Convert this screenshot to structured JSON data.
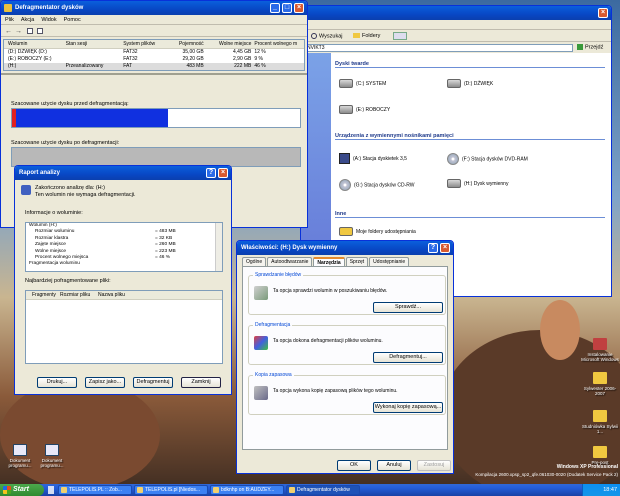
{
  "desktop": {
    "icons": [
      {
        "label": "Instalowanie Microsoft Windows"
      },
      {
        "label": "Sylwester 2006-2007"
      },
      {
        "label": "Studniówka Sylwii 1..."
      },
      {
        "label": "Pre-post"
      }
    ],
    "left_icons": [
      {
        "label": "Dokument programu..."
      },
      {
        "label": "Dokument programu..."
      }
    ],
    "watermark": [
      "Windows XP Professional",
      "Kompilacja 2600.xpsp_sp2_qfe.061030-0020 (Dodatek Service Pack 2)"
    ]
  },
  "explorer": {
    "toolbar": {
      "search": "Wyszukaj",
      "folders": "Foldery"
    },
    "address": {
      "value": "NVIKT3",
      "go": "Przejdź"
    },
    "sections": {
      "hard_drives": "Dyski twarde",
      "removable": "Urządzenia z wymiennymi nośnikami pamięci",
      "other": "Inne"
    },
    "drives": [
      {
        "label": "(C:) SYSTEM"
      },
      {
        "label": "(D:) DŹWIĘK"
      },
      {
        "label": "(E:) ROBOCZY"
      }
    ],
    "removable": [
      {
        "label": "(A:) Stacja dyskietek 3,5"
      },
      {
        "label": "(F:) Stacja dysków DVD-RAM"
      },
      {
        "label": "(G:) Stacja dysków CD-RW"
      },
      {
        "label": "(H:) Dysk wymienny"
      }
    ],
    "other": [
      {
        "label": "Moje foldery udostępniania"
      }
    ]
  },
  "defrag": {
    "title": "Defragmentator dysków",
    "menu": [
      "Plik",
      "Akcja",
      "Widok",
      "Pomoc"
    ],
    "columns": [
      "Wolumin",
      "Stan sesji",
      "System plików",
      "Pojemność",
      "Wolne miejsce",
      "Procent wolnego m"
    ],
    "rows": [
      [
        "(D:) DŹWIĘK (D:)",
        "",
        "FAT32",
        "35,00 GB",
        "4,45 GB",
        "12 %"
      ],
      [
        "(E:) ROBOCZY (E:)",
        "",
        "FAT32",
        "29,20 GB",
        "2,90 GB",
        "9 %"
      ],
      [
        "(H:)",
        "Przeanalizowany",
        "FAT",
        "483 MB",
        "222 MB",
        "46 %"
      ]
    ],
    "before_label": "Szacowane użycie dysku przed defragmentacją:",
    "after_label": "Szacowane użycie dysku po defragmentacji:"
  },
  "report": {
    "title": "Raport analizy",
    "line1": "Zakończono analizę dla: (H:)",
    "line2": "Ten wolumin nie wymaga defragmentacji.",
    "info_label": "Informacje o woluminie:",
    "info": [
      {
        "k": "Wolumin (H:)",
        "v": ""
      },
      {
        "k": "Rozmiar woluminu",
        "v": "= 483 MB"
      },
      {
        "k": "Rozmiar klastra",
        "v": "= 32 KB"
      },
      {
        "k": "Zajęte miejsce",
        "v": "= 260 MB"
      },
      {
        "k": "Wolne miejsce",
        "v": "= 223 MB"
      },
      {
        "k": "Procent wolnego miejsca",
        "v": "= 46 %"
      },
      {
        "k": "Fragmentacja woluminu",
        "v": ""
      }
    ],
    "frag_label": "Najbardziej pofragmentowane pliki:",
    "frag_columns": [
      "Fragmenty",
      "Rozmiar pliku",
      "Nazwa pliku"
    ],
    "buttons": {
      "print": "Drukuj...",
      "save": "Zapisz jako...",
      "defrag": "Defragmentuj",
      "close": "Zamknij"
    }
  },
  "props": {
    "title": "Właściwości: (H:) Dysk wymienny",
    "tabs": [
      "Ogólne",
      "Autoodtwarzanie",
      "Narzędzia",
      "Sprzęt",
      "Udostępnianie"
    ],
    "active_tab": "Narzędzia",
    "groups": [
      {
        "title": "Sprawdzanie błędów",
        "text": "Ta opcja sprawdzi wolumin w poszukiwaniu błędów.",
        "button": "Sprawdź..."
      },
      {
        "title": "Defragmentacja",
        "text": "Ta opcja dokona defragmentacji plików woluminu.",
        "button": "Defragmentuj..."
      },
      {
        "title": "Kopia zapasowa",
        "text": "Ta opcja wykona kopię zapasową plików tego woluminu.",
        "button": "Wykonaj kopię zapasową..."
      }
    ],
    "buttons": {
      "ok": "OK",
      "cancel": "Anuluj",
      "apply": "Zastosuj"
    }
  },
  "taskbar": {
    "start": "Start",
    "tasks": [
      "TELEPOLIS.PL :: Zob...",
      "TELEPOLIS.pl [Niedos...",
      "bdknhp on B:AUDZEY...",
      "Defragmentator dysków"
    ],
    "clock": "18:47"
  }
}
